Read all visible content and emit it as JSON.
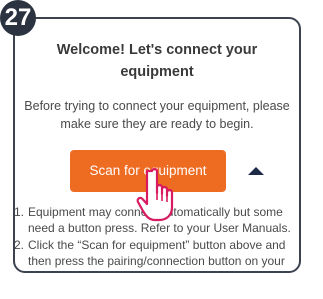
{
  "step_badge": "27",
  "card": {
    "title": "Welcome! Let's connect your equipment",
    "intro": "Before trying to connect your equipment, please make sure they are ready to begin.",
    "scan_button_label": "Scan for equipment",
    "collapse_icon": "chevron-up-icon",
    "steps": [
      {
        "number": "1.",
        "text": "Equipment may connect automatically but some need a button press. Refer to your User Manuals."
      },
      {
        "number": "2.",
        "text": "Click the “Scan for equipment” button above and then press the pairing/connection button on your equipment."
      }
    ]
  },
  "cursor_icon": "hand-pointer-icon",
  "colors": {
    "accent": "#ee6b22",
    "badge": "#2c3340",
    "caret": "#1e2a48"
  }
}
